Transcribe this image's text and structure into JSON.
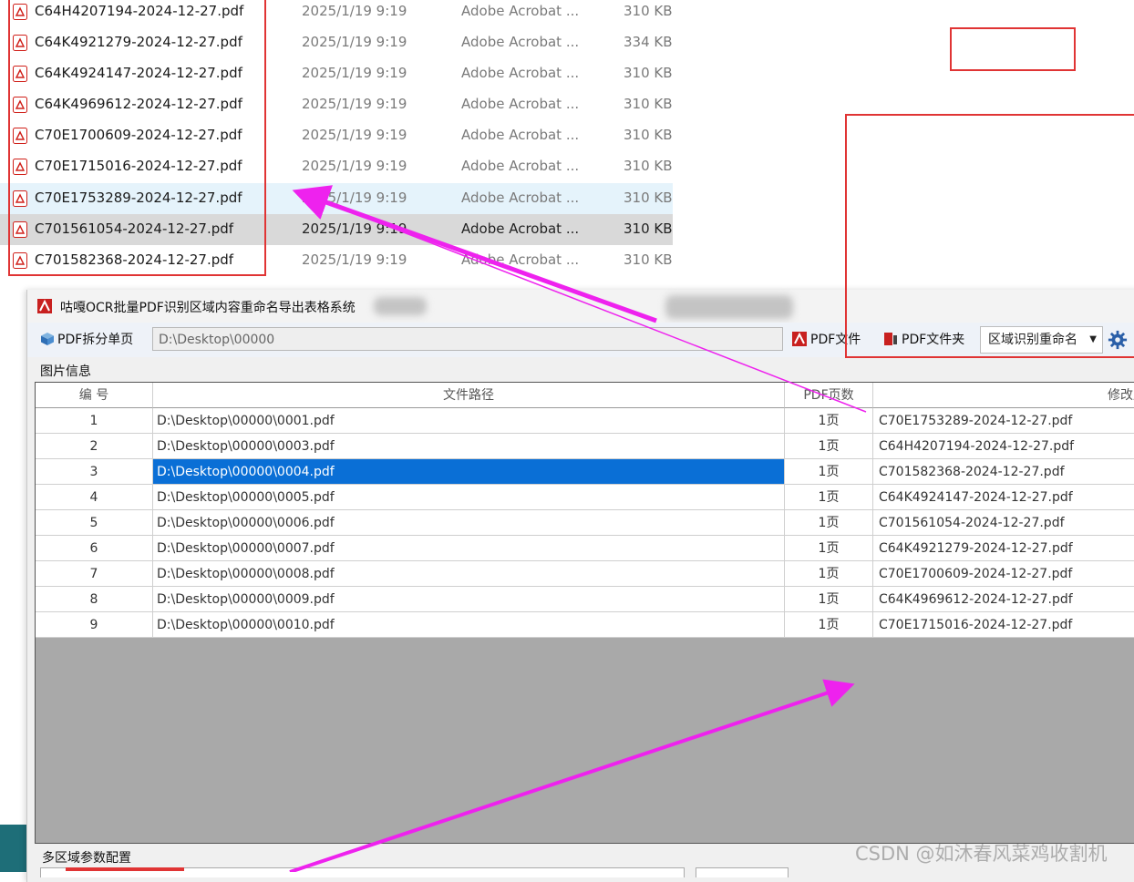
{
  "explorer": {
    "files": [
      {
        "name": "C64H4207194-2024-12-27.pdf",
        "date": "2025/1/19 9:19",
        "type": "Adobe Acrobat ...",
        "size": "310 KB"
      },
      {
        "name": "C64K4921279-2024-12-27.pdf",
        "date": "2025/1/19 9:19",
        "type": "Adobe Acrobat ...",
        "size": "334 KB"
      },
      {
        "name": "C64K4924147-2024-12-27.pdf",
        "date": "2025/1/19 9:19",
        "type": "Adobe Acrobat ...",
        "size": "310 KB"
      },
      {
        "name": "C64K4969612-2024-12-27.pdf",
        "date": "2025/1/19 9:19",
        "type": "Adobe Acrobat ...",
        "size": "310 KB"
      },
      {
        "name": "C70E1700609-2024-12-27.pdf",
        "date": "2025/1/19 9:19",
        "type": "Adobe Acrobat ...",
        "size": "310 KB"
      },
      {
        "name": "C70E1715016-2024-12-27.pdf",
        "date": "2025/1/19 9:19",
        "type": "Adobe Acrobat ...",
        "size": "310 KB"
      },
      {
        "name": "C70E1753289-2024-12-27.pdf",
        "date": "2025/1/19 9:19",
        "type": "Adobe Acrobat ...",
        "size": "310 KB"
      },
      {
        "name": "C701561054-2024-12-27.pdf",
        "date": "2025/1/19 9:19",
        "type": "Adobe Acrobat ...",
        "size": "310 KB"
      },
      {
        "name": "C701582368-2024-12-27.pdf",
        "date": "2025/1/19 9:19",
        "type": "Adobe Acrobat ...",
        "size": "310 KB"
      }
    ]
  },
  "app": {
    "title": "咕嘎OCR批量PDF识别区域内容重命名导出表格系统",
    "toolbar": {
      "split_label": "PDF拆分单页",
      "path_value": "D:\\Desktop\\00000",
      "pdf_file_label": "PDF文件",
      "pdf_folder_label": "PDF文件夹",
      "mode_value": "区域识别重命名"
    },
    "section_label": "图片信息",
    "grid": {
      "headers": [
        "编 号",
        "文件路径",
        "PDF页数",
        "修改后文"
      ],
      "rows": [
        [
          "1",
          "D:\\Desktop\\00000\\0001.pdf",
          "1页",
          "C70E1753289-2024-12-27.pdf"
        ],
        [
          "2",
          "D:\\Desktop\\00000\\0003.pdf",
          "1页",
          "C64H4207194-2024-12-27.pdf"
        ],
        [
          "3",
          "D:\\Desktop\\00000\\0004.pdf",
          "1页",
          "C701582368-2024-12-27.pdf"
        ],
        [
          "4",
          "D:\\Desktop\\00000\\0005.pdf",
          "1页",
          "C64K4924147-2024-12-27.pdf"
        ],
        [
          "5",
          "D:\\Desktop\\00000\\0006.pdf",
          "1页",
          "C701561054-2024-12-27.pdf"
        ],
        [
          "6",
          "D:\\Desktop\\00000\\0007.pdf",
          "1页",
          "C64K4921279-2024-12-27.pdf"
        ],
        [
          "7",
          "D:\\Desktop\\00000\\0008.pdf",
          "1页",
          "C70E1700609-2024-12-27.pdf"
        ],
        [
          "8",
          "D:\\Desktop\\00000\\0009.pdf",
          "1页",
          "C64K4969612-2024-12-27.pdf"
        ],
        [
          "9",
          "D:\\Desktop\\00000\\0010.pdf",
          "1页",
          "C70E1715016-2024-12-27.pdf"
        ]
      ]
    },
    "multi_region_label": "多区域参数配置"
  },
  "watermark": "CSDN @如沐春风菜鸡收割机",
  "colors": {
    "annotation_red": "#e03434",
    "arrow_magenta": "#ee22ee",
    "selection_blue": "#0a6fd6"
  }
}
